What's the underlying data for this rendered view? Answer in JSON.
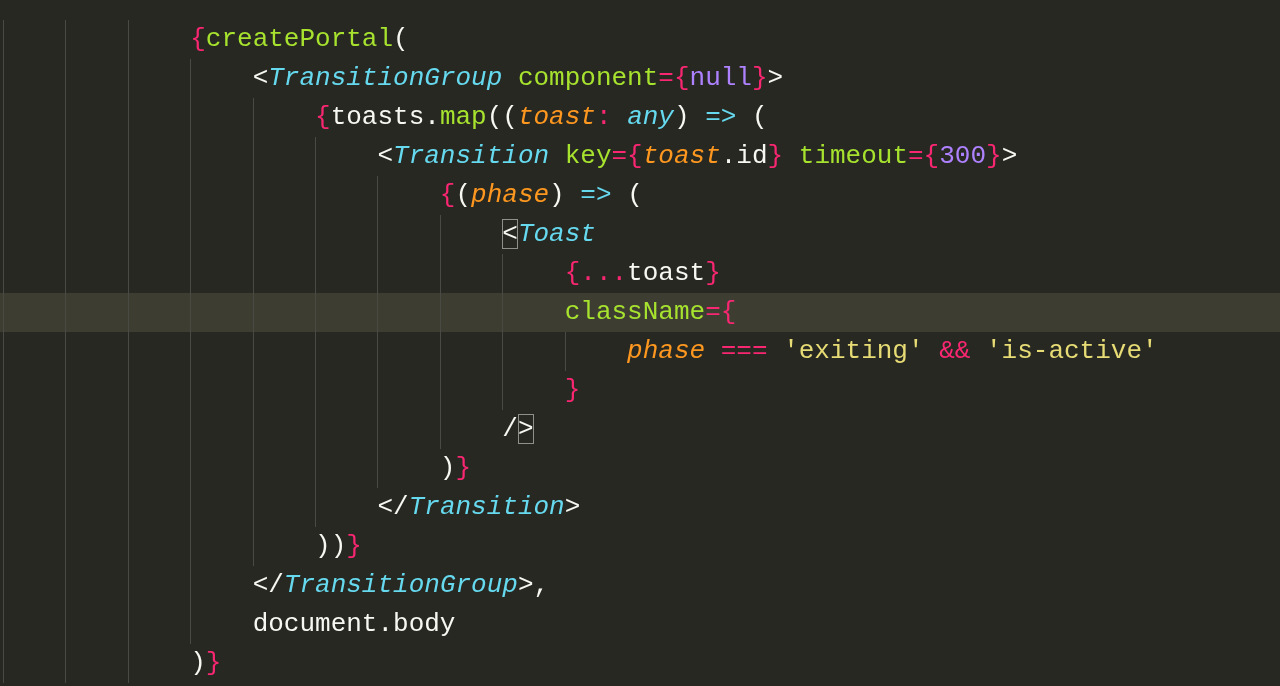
{
  "lines": [
    {
      "current": false,
      "tokens": [
        {
          "text": "{",
          "kind": "operator"
        },
        {
          "text": "createPortal",
          "kind": "function"
        },
        {
          "text": "(",
          "kind": "plain"
        }
      ],
      "children": [
        {
          "current": false,
          "tokens": [
            {
              "text": "<",
              "kind": "plain"
            },
            {
              "text": "TransitionGroup",
              "kind": "tag"
            },
            {
              "text": " component",
              "kind": "attribute"
            },
            {
              "text": "={",
              "kind": "operator"
            },
            {
              "text": "null",
              "kind": "number"
            },
            {
              "text": "}",
              "kind": "operator"
            },
            {
              "text": ">",
              "kind": "plain"
            }
          ],
          "children": [
            {
              "current": false,
              "tokens": [
                {
                  "text": "{",
                  "kind": "operator"
                },
                {
                  "text": "toasts.",
                  "kind": "plain"
                },
                {
                  "text": "map",
                  "kind": "function"
                },
                {
                  "text": "((",
                  "kind": "plain"
                },
                {
                  "text": "toast",
                  "kind": "parameter"
                },
                {
                  "text": ": ",
                  "kind": "operator"
                },
                {
                  "text": "any",
                  "kind": "type"
                },
                {
                  "text": ") ",
                  "kind": "plain"
                },
                {
                  "text": "=>",
                  "kind": "type"
                },
                {
                  "text": " (",
                  "kind": "plain"
                }
              ],
              "children": [
                {
                  "current": false,
                  "tokens": [
                    {
                      "text": "<",
                      "kind": "plain"
                    },
                    {
                      "text": "Transition",
                      "kind": "tag"
                    },
                    {
                      "text": " key",
                      "kind": "attribute"
                    },
                    {
                      "text": "={",
                      "kind": "operator"
                    },
                    {
                      "text": "toast",
                      "kind": "parameter"
                    },
                    {
                      "text": ".id",
                      "kind": "plain"
                    },
                    {
                      "text": "}",
                      "kind": "operator"
                    },
                    {
                      "text": " timeout",
                      "kind": "attribute"
                    },
                    {
                      "text": "={",
                      "kind": "operator"
                    },
                    {
                      "text": "300",
                      "kind": "number"
                    },
                    {
                      "text": "}",
                      "kind": "operator"
                    },
                    {
                      "text": ">",
                      "kind": "plain"
                    }
                  ],
                  "children": [
                    {
                      "current": false,
                      "tokens": [
                        {
                          "text": "{",
                          "kind": "operator"
                        },
                        {
                          "text": "(",
                          "kind": "plain"
                        },
                        {
                          "text": "phase",
                          "kind": "parameter"
                        },
                        {
                          "text": ") ",
                          "kind": "plain"
                        },
                        {
                          "text": "=>",
                          "kind": "type"
                        },
                        {
                          "text": " (",
                          "kind": "plain"
                        }
                      ],
                      "children": [
                        {
                          "current": false,
                          "tokens": [
                            {
                              "text": "<",
                              "kind": "plain",
                              "matched": true
                            },
                            {
                              "text": "Toast",
                              "kind": "tag"
                            }
                          ],
                          "children": [
                            {
                              "current": false,
                              "tokens": [
                                {
                                  "text": "{...",
                                  "kind": "operator"
                                },
                                {
                                  "text": "toast",
                                  "kind": "plain"
                                },
                                {
                                  "text": "}",
                                  "kind": "operator"
                                }
                              ]
                            },
                            {
                              "current": true,
                              "tokens": [
                                {
                                  "text": "className",
                                  "kind": "attribute"
                                },
                                {
                                  "text": "={",
                                  "kind": "operator"
                                }
                              ],
                              "children": [
                                {
                                  "current": false,
                                  "tokens": [
                                    {
                                      "text": "phase",
                                      "kind": "parameter"
                                    },
                                    {
                                      "text": " ===",
                                      "kind": "operator"
                                    },
                                    {
                                      "text": " 'exiting'",
                                      "kind": "string"
                                    },
                                    {
                                      "text": " &&",
                                      "kind": "operator"
                                    },
                                    {
                                      "text": " 'is-active'",
                                      "kind": "string"
                                    }
                                  ]
                                }
                              ]
                            },
                            {
                              "current": false,
                              "tokens": [
                                {
                                  "text": "}",
                                  "kind": "operator"
                                }
                              ]
                            }
                          ]
                        },
                        {
                          "current": false,
                          "tokens": [
                            {
                              "text": "/",
                              "kind": "plain"
                            },
                            {
                              "text": ">",
                              "kind": "plain",
                              "matched": true
                            }
                          ]
                        }
                      ]
                    },
                    {
                      "current": false,
                      "tokens": [
                        {
                          "text": ")",
                          "kind": "plain"
                        },
                        {
                          "text": "}",
                          "kind": "operator"
                        }
                      ]
                    }
                  ]
                },
                {
                  "current": false,
                  "tokens": [
                    {
                      "text": "</",
                      "kind": "plain"
                    },
                    {
                      "text": "Transition",
                      "kind": "tag"
                    },
                    {
                      "text": ">",
                      "kind": "plain"
                    }
                  ]
                }
              ]
            },
            {
              "current": false,
              "tokens": [
                {
                  "text": "))",
                  "kind": "plain"
                },
                {
                  "text": "}",
                  "kind": "operator"
                }
              ]
            }
          ]
        },
        {
          "current": false,
          "tokens": [
            {
              "text": "</",
              "kind": "plain"
            },
            {
              "text": "TransitionGroup",
              "kind": "tag"
            },
            {
              "text": ">,",
              "kind": "plain"
            }
          ]
        },
        {
          "current": false,
          "tokens": [
            {
              "text": "document.body",
              "kind": "plain"
            }
          ]
        }
      ]
    },
    {
      "current": false,
      "tokens": [
        {
          "text": ")",
          "kind": "plain"
        },
        {
          "text": "}",
          "kind": "operator"
        }
      ]
    }
  ]
}
